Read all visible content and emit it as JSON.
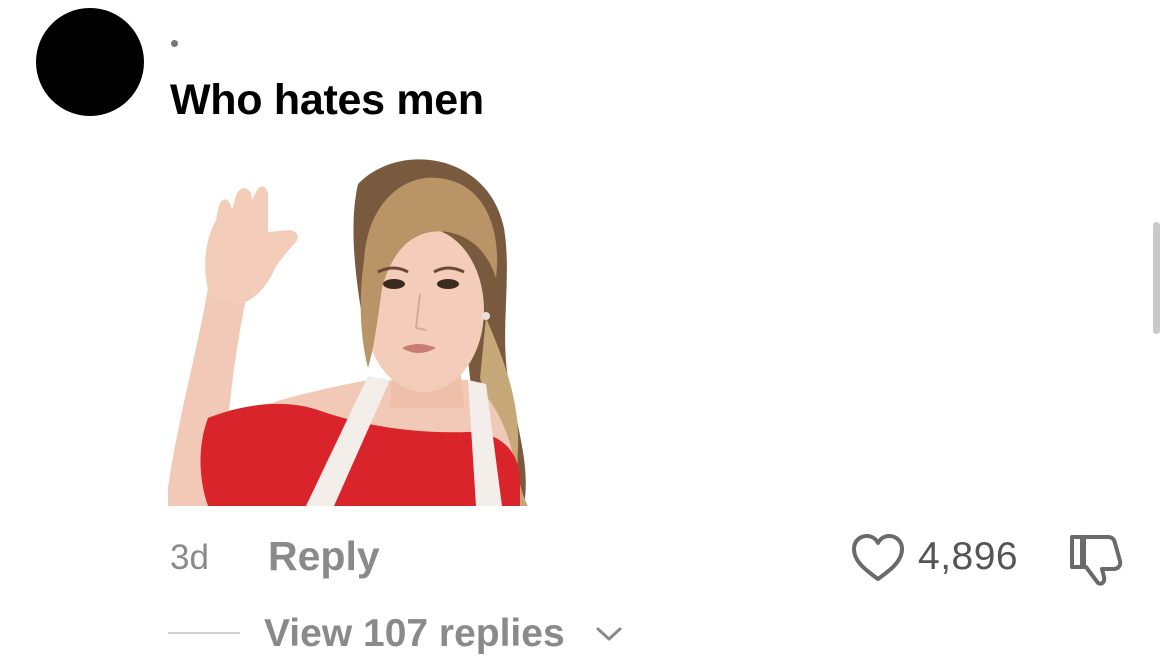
{
  "comment": {
    "text": "Who hates men",
    "timestamp": "3d",
    "reply_label": "Reply",
    "like_count": "4,896",
    "view_replies_label": "View 107 replies"
  },
  "icons": {
    "like": "heart-outline-icon",
    "dislike": "thumbs-down-outline-icon",
    "expand": "chevron-down-icon"
  },
  "colors": {
    "text": "#000000",
    "muted": "#8a8a8a",
    "sticker_dress": "#d9242b"
  }
}
